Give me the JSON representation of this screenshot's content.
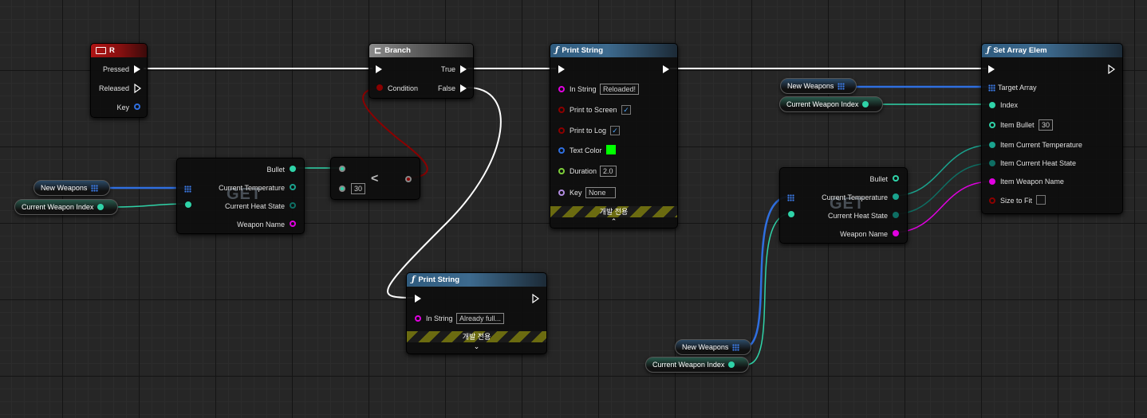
{
  "nodes": {
    "r_event": {
      "title": "R",
      "pressed": "Pressed",
      "released": "Released",
      "key": "Key"
    },
    "branch": {
      "title": "Branch",
      "condition": "Condition",
      "true_label": "True",
      "false_label": "False"
    },
    "print1": {
      "title": "Print String",
      "in_string": "In String",
      "in_string_value": "Reloaded!",
      "print_to_screen": "Print to Screen",
      "print_to_log": "Print to Log",
      "text_color": "Text Color",
      "duration": "Duration",
      "duration_value": "2.0",
      "key": "Key",
      "key_value": "None",
      "dev_only": "개발 전용",
      "text_color_value": "#00ff00"
    },
    "print2": {
      "title": "Print String",
      "in_string": "In String",
      "in_string_value": "Already full...",
      "dev_only": "개발 전용"
    },
    "set_array": {
      "title": "Set Array Elem",
      "target_array": "Target Array",
      "index": "Index",
      "item_bullet": "Item Bullet",
      "item_bullet_value": "30",
      "item_current_temperature": "Item Current Temperature",
      "item_current_heat_state": "Item Current Heat State",
      "item_weapon_name": "Item Weapon Name",
      "size_to_fit": "Size to Fit"
    },
    "get1": {
      "watermark": "GET",
      "bullet": "Bullet",
      "current_temperature": "Current Temperature",
      "current_heat_state": "Current Heat State",
      "weapon_name": "Weapon Name"
    },
    "get2": {
      "watermark": "GET",
      "bullet": "Bullet",
      "current_temperature": "Current Temperature",
      "current_heat_state": "Current Heat State",
      "weapon_name": "Weapon Name"
    },
    "less": {
      "symbol": "<",
      "b_value": "30"
    }
  },
  "variables": {
    "new_weapons": "New Weapons",
    "current_weapon_index": "Current Weapon Index"
  },
  "colors": {
    "exec": "#ffffff",
    "array": "#2f6fe0",
    "int": "#2fd3a8",
    "bool": "#8b0000",
    "struct_teal": "#1aa38e",
    "string": "#e000e0",
    "enum": "#0e6e63"
  },
  "icons": {
    "keyboard": "keyboard-icon",
    "branch": "branch-icon",
    "function": "function-icon",
    "exec_pin": "exec-pin-icon",
    "array_grid": "array-grid-icon",
    "chevron": "chevron-up-icon"
  }
}
